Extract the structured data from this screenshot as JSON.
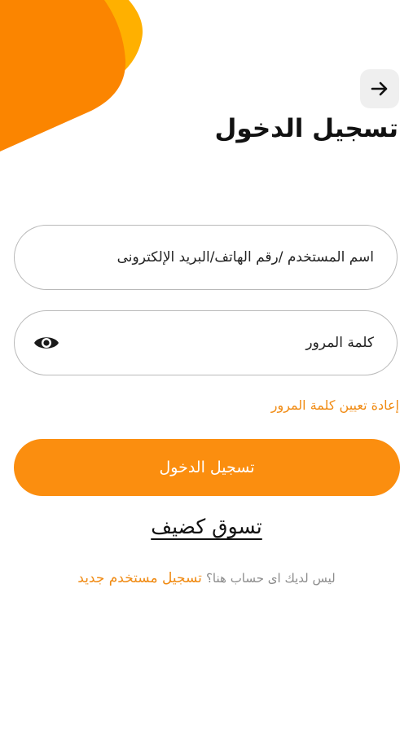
{
  "header": {
    "back_icon": "arrow-right-icon",
    "title": "تسجيل الدخول"
  },
  "form": {
    "username_placeholder": "اسم المستخدم /رقم الهاتف/البريد الإلكترونى",
    "password_placeholder": "كلمة المرور",
    "password_toggle_icon": "eye-icon",
    "forgot_password": "إعادة تعيين كلمة المرور",
    "login_button": "تسجيل الدخول"
  },
  "guest_shopping": "تسوق كضيف",
  "register": {
    "prompt": "ليس لديك اى حساب هنا؟",
    "link": "تسجيل مستخدم جديد"
  },
  "colors": {
    "accent": "#fb8e0f",
    "blob_dark": "#fb8500",
    "blob_light": "#ffb000"
  }
}
